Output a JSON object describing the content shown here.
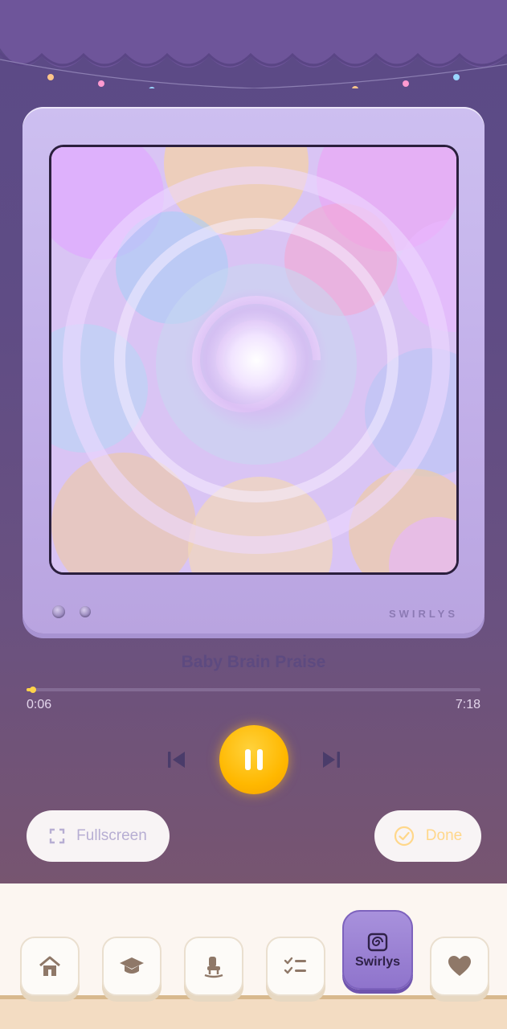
{
  "player": {
    "brand": "SWIRLYS",
    "track_title": "Baby Brain Praise",
    "elapsed": "0:06",
    "duration": "7:18",
    "progress": 0.014
  },
  "actions": {
    "fullscreen_label": "Fullscreen",
    "done_label": "Done"
  },
  "nav": {
    "active_label": "Swirlys",
    "items": [
      "home-icon",
      "graduation-cap-icon",
      "rocking-chair-icon",
      "checklist-icon",
      "swirl-icon",
      "heart-icon"
    ]
  },
  "colors": {
    "accent": "#ffb800",
    "tv": "#c3b1ea",
    "background": "#5f4c85"
  }
}
